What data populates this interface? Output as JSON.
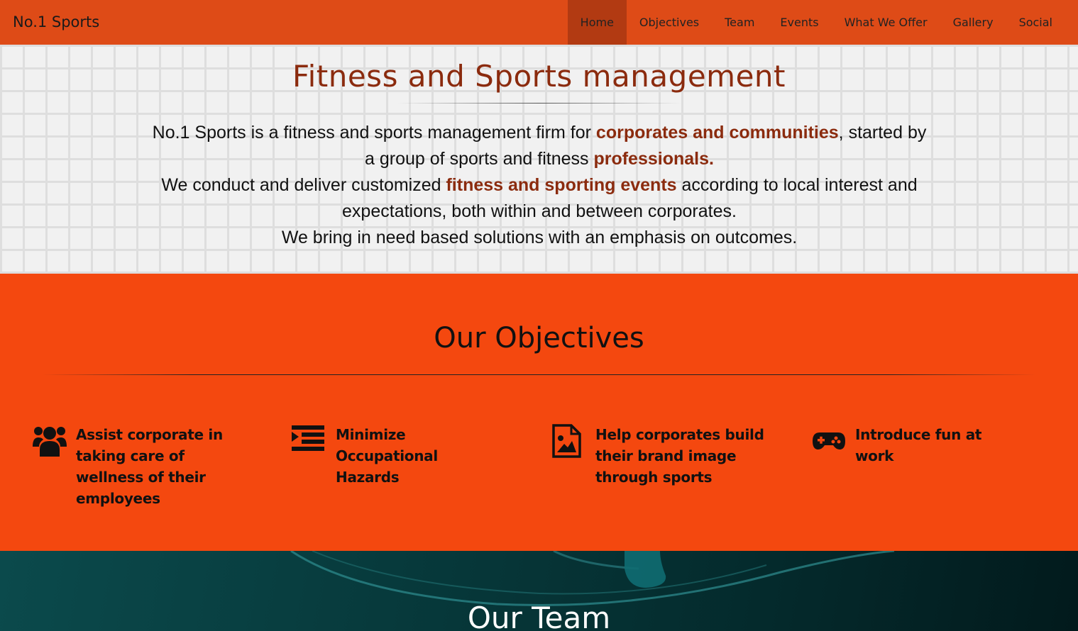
{
  "nav": {
    "brand": "No.1 Sports",
    "items": [
      {
        "label": "Home"
      },
      {
        "label": "Objectives"
      },
      {
        "label": "Team"
      },
      {
        "label": "Events"
      },
      {
        "label": "What We Offer"
      },
      {
        "label": "Gallery"
      },
      {
        "label": "Social"
      }
    ],
    "active_color": "#b23a12",
    "bar_color": "#de4b17"
  },
  "intro": {
    "title": "Fitness and Sports management",
    "p1_a": "No.1 Sports is a fitness and sports management firm for ",
    "p1_hl": "corporates and communities",
    "p1_b": ", started by a group of sports and fitness ",
    "p1_hl2": "professionals.",
    "p2_a": "We conduct and deliver customized ",
    "p2_hl": "fitness and sporting events",
    "p2_b": " according to local interest and expectations, both within and between corporates.",
    "p3": "We bring in need based solutions with an emphasis on outcomes.",
    "highlight_color": "#8b2b0e"
  },
  "objectives": {
    "title": "Our Objectives",
    "background_color": "#f4480f",
    "items": [
      {
        "icon": "users-icon",
        "text": "Assist corporate in taking care of wellness of their employees"
      },
      {
        "icon": "indent-icon",
        "text": "Minimize Occupational Hazards"
      },
      {
        "icon": "image-icon",
        "text": "Help corporates build their brand image through sports"
      },
      {
        "icon": "gamepad-icon",
        "text": "Introduce fun at work"
      }
    ]
  },
  "team": {
    "title": "Our Team"
  }
}
